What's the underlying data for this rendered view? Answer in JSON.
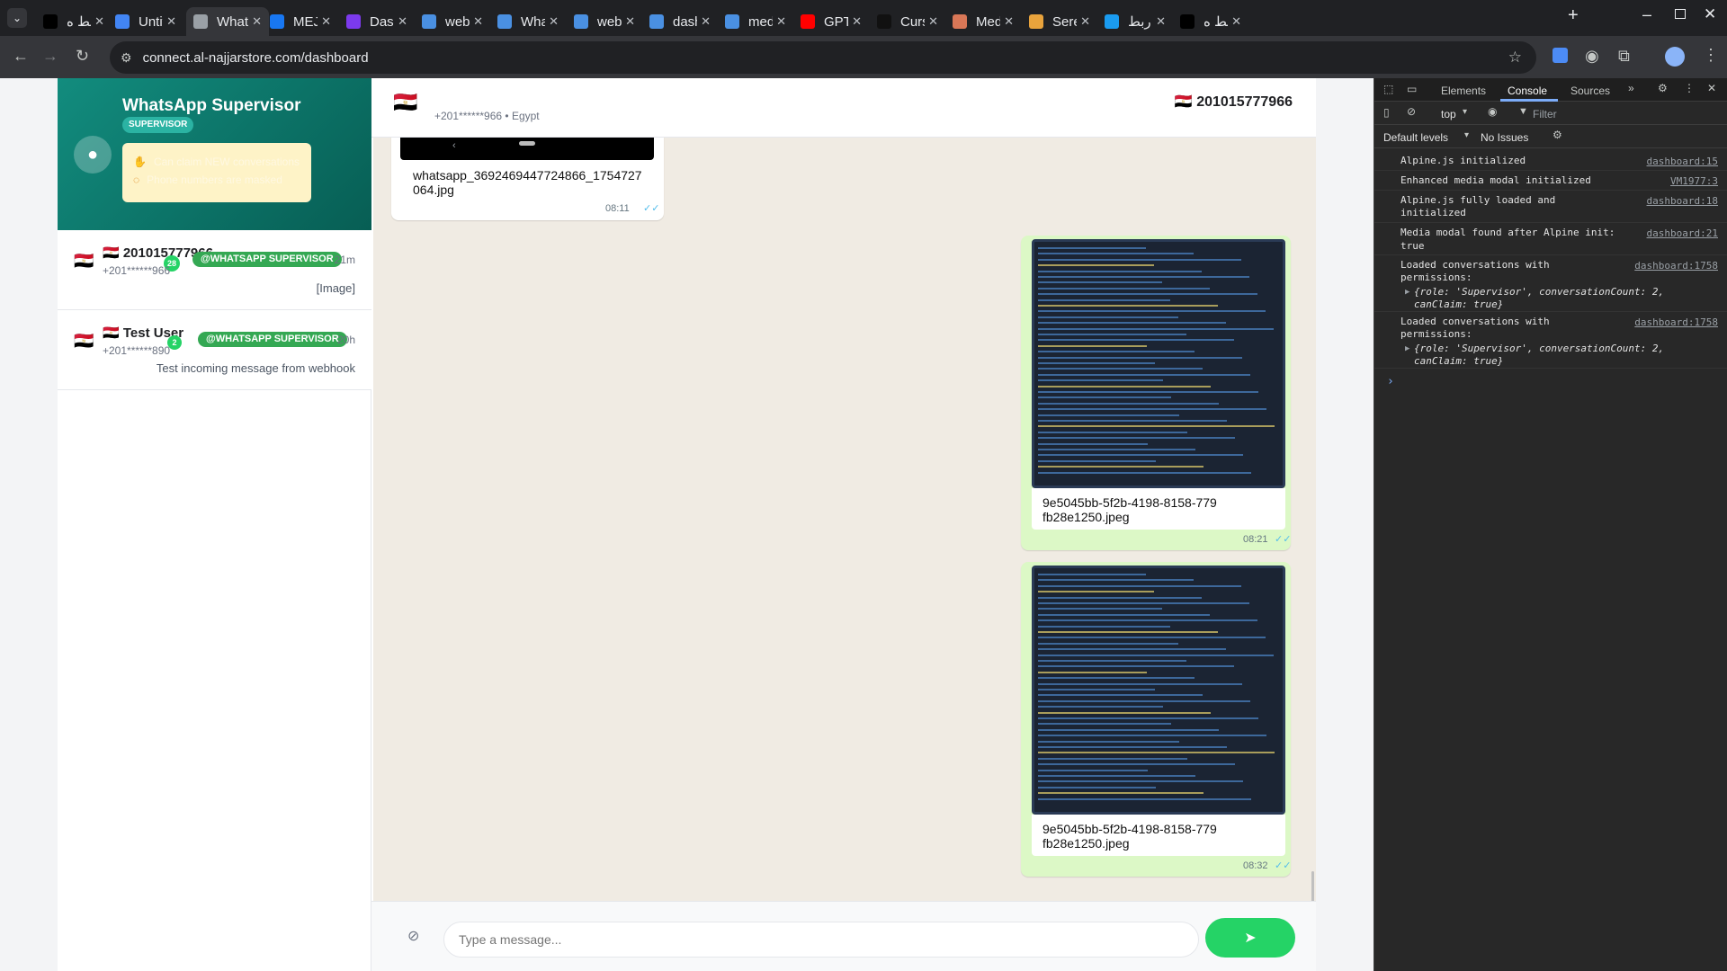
{
  "browser": {
    "tabs": [
      {
        "title": "ربط ه",
        "icon": "tiktok-icon",
        "color": "#000000"
      },
      {
        "title": "Untitl",
        "icon": "google-docs-icon",
        "color": "#4285f4"
      },
      {
        "title": "What",
        "icon": "globe-icon",
        "color": "#9aa0a6",
        "active": true
      },
      {
        "title": "MEJ",
        "icon": "facebook-icon",
        "color": "#1877f2"
      },
      {
        "title": "Dash",
        "icon": "dashboard-icon",
        "color": "#7c3aed"
      },
      {
        "title": "web.",
        "icon": "openai-icon",
        "color": "#4a90e2"
      },
      {
        "title": "What",
        "icon": "openai-icon",
        "color": "#4a90e2"
      },
      {
        "title": "web.",
        "icon": "openai-icon",
        "color": "#4a90e2"
      },
      {
        "title": "dash",
        "icon": "openai-icon",
        "color": "#4a90e2"
      },
      {
        "title": "medi",
        "icon": "openai-icon",
        "color": "#4a90e2"
      },
      {
        "title": "GPT-",
        "icon": "youtube-icon",
        "color": "#ff0000"
      },
      {
        "title": "Curs",
        "icon": "cursor-icon",
        "color": "#111111"
      },
      {
        "title": "Medi",
        "icon": "claude-icon",
        "color": "#d97757"
      },
      {
        "title": "Sere",
        "icon": "serena-icon",
        "color": "#e8a33c"
      },
      {
        "title": "ربط",
        "icon": "blue-circle-icon",
        "color": "#1a9bf0"
      },
      {
        "title": "ربط ه",
        "icon": "tiktok-icon",
        "color": "#000000"
      }
    ],
    "url": "connect.al-najjarstore.com/dashboard"
  },
  "sidebar": {
    "app_title": "WhatsApp Supervisor",
    "role_badge": "SUPERVISOR",
    "permissions": [
      {
        "icon": "hand-icon",
        "text": "Can claim NEW conversations"
      },
      {
        "icon": "eye-slash-icon",
        "text": "Phone numbers are masked"
      }
    ],
    "conversations": [
      {
        "flag": "🇪🇬",
        "name": "🇪🇬 201015777966",
        "unread": "28",
        "tag": "@WHATSAPP SUPERVISOR",
        "time": "21m",
        "phone": "+201******966",
        "preview": "[Image]"
      },
      {
        "flag": "🇪🇬",
        "name": "🇪🇬 Test User",
        "unread": "2",
        "tag": "@WHATSAPP SUPERVISOR",
        "time": "20h",
        "phone": "+201******890",
        "preview": "Test incoming message from webhook"
      }
    ]
  },
  "chat": {
    "header_flag": "🇪🇬",
    "header_sub": "+201******966 • Egypt",
    "header_title": "🇪🇬 201015777966",
    "messages": [
      {
        "direction": "in",
        "filename": "whatsapp_36924694477248​66_1754727064.jpg",
        "time": "08:11"
      },
      {
        "direction": "out",
        "filename": "9e5045bb-5f2b-4198-8158-779fb28e1250.jpeg",
        "time": "08:21"
      },
      {
        "direction": "out",
        "filename": "9e5045bb-5f2b-4198-8158-779fb28e1250.jpeg",
        "time": "08:32"
      }
    ],
    "composer_placeholder": "Type a message..."
  },
  "devtools": {
    "tabs": [
      "Elements",
      "Console",
      "Sources"
    ],
    "active_tab": "Console",
    "context": "top",
    "filter_placeholder": "Filter",
    "levels": "Default levels",
    "issues": "No Issues",
    "logs": [
      {
        "text": "Alpine.js initialized",
        "source": "dashboard:15"
      },
      {
        "text": "Enhanced media modal initialized",
        "source": "VM1977:3"
      },
      {
        "text": "Alpine.js fully loaded and initialized",
        "source": "dashboard:18"
      },
      {
        "text": "Media modal found after Alpine init:",
        "value": "true",
        "source": "dashboard:21"
      },
      {
        "text": "Loaded conversations with permissions:",
        "object": "{role: 'Supervisor', conversationCount: 2, canClaim: true}",
        "source": "dashboard:1758"
      },
      {
        "text": "Loaded conversations with permissions:",
        "object": "{role: 'Supervisor', conversationCount: 2, canClaim: true}",
        "source": "dashboard:1758"
      }
    ]
  }
}
